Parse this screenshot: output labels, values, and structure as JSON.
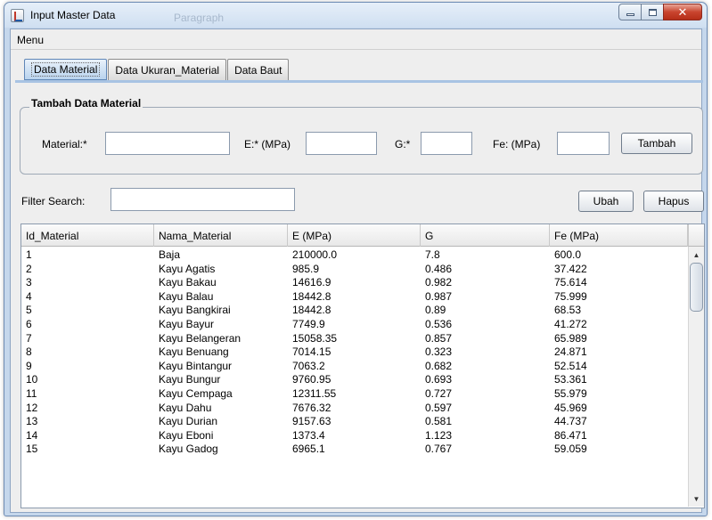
{
  "window": {
    "title": "Input Master Data",
    "ghost_text": "Paragraph"
  },
  "menu": {
    "label": "Menu"
  },
  "tabs": [
    {
      "label": "Data Material",
      "active": true
    },
    {
      "label": "Data Ukuran_Material",
      "active": false
    },
    {
      "label": "Data Baut",
      "active": false
    }
  ],
  "form": {
    "group_title": "Tambah Data Material",
    "material_label": "Material:*",
    "material_value": "",
    "e_label": "E:* (MPa)",
    "e_value": "",
    "g_label": "G:*",
    "g_value": "",
    "fe_label": "Fe: (MPa)",
    "fe_value": "",
    "add_button": "Tambah"
  },
  "filter": {
    "label": "Filter Search:",
    "value": "",
    "edit_button": "Ubah",
    "delete_button": "Hapus"
  },
  "table": {
    "columns": [
      "Id_Material",
      "Nama_Material",
      "E (MPa)",
      "G",
      "Fe (MPa)"
    ],
    "rows": [
      [
        "1",
        "Baja",
        "210000.0",
        "7.8",
        "600.0"
      ],
      [
        "2",
        "Kayu Agatis",
        "985.9",
        "0.486",
        "37.422"
      ],
      [
        "3",
        "Kayu Bakau",
        "14616.9",
        "0.982",
        "75.614"
      ],
      [
        "4",
        "Kayu Balau",
        "18442.8",
        "0.987",
        "75.999"
      ],
      [
        "5",
        "Kayu Bangkirai",
        "18442.8",
        "0.89",
        "68.53"
      ],
      [
        "6",
        "Kayu Bayur",
        "7749.9",
        "0.536",
        "41.272"
      ],
      [
        "7",
        "Kayu Belangeran",
        "15058.35",
        "0.857",
        "65.989"
      ],
      [
        "8",
        "Kayu Benuang",
        "7014.15",
        "0.323",
        "24.871"
      ],
      [
        "9",
        "Kayu Bintangur",
        "7063.2",
        "0.682",
        "52.514"
      ],
      [
        "10",
        "Kayu Bungur",
        "9760.95",
        "0.693",
        "53.361"
      ],
      [
        "11",
        "Kayu Cempaga",
        "12311.55",
        "0.727",
        "55.979"
      ],
      [
        "12",
        "Kayu Dahu",
        "7676.32",
        "0.597",
        "45.969"
      ],
      [
        "13",
        "Kayu Durian",
        "9157.63",
        "0.581",
        "44.737"
      ],
      [
        "14",
        "Kayu Eboni",
        "1373.4",
        "1.123",
        "86.471"
      ],
      [
        "15",
        "Kayu Gadog",
        "6965.1",
        "0.767",
        "59.059"
      ]
    ]
  },
  "icons": {
    "app": "java-app-icon",
    "minimize": "minimize-icon",
    "maximize": "maximize-icon",
    "close": "close-icon",
    "scroll_up": "scroll-up-arrow-icon",
    "scroll_down": "scroll-down-arrow-icon"
  }
}
